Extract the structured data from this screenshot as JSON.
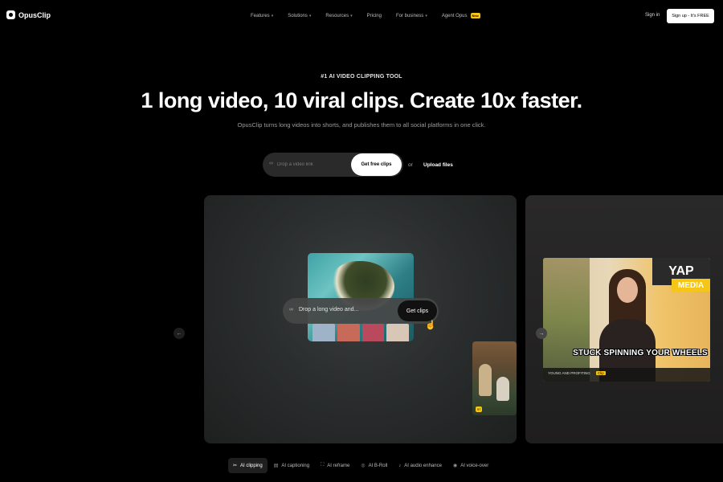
{
  "nav": {
    "logo_text": "OpusClip",
    "links": [
      {
        "label": "Features",
        "chevron": "▾"
      },
      {
        "label": "Solutions",
        "chevron": "▾"
      },
      {
        "label": "Resources",
        "chevron": "▾"
      },
      {
        "label": "Pricing",
        "chevron": ""
      },
      {
        "label": "For business",
        "chevron": "▾"
      },
      {
        "label": "Agent Opus",
        "chevron": ""
      }
    ],
    "agent_badge": "New",
    "signin": "Sign in",
    "signup": "Sign up - It's FREE"
  },
  "hero": {
    "eyebrow": "#1 AI VIDEO CLIPPING TOOL",
    "headline": "1 long video, 10 viral clips. Create 10x faster.",
    "subhead": "OpusClip turns long videos into shorts, and publishes them to all social platforms in one click.",
    "input_placeholder": "Drop a video link",
    "cta": "Get free clips",
    "or": "or",
    "upload": "Upload files"
  },
  "showcase": {
    "drop_text": "Drop a long video and...",
    "get_clips": "Get clips",
    "caption": "STUCK SPINNING YOUR WHEELS",
    "caption_sub": "YOUNG AND PROFITING",
    "caption_badge": "Clip",
    "yap": "YAP",
    "media": "MEDIA",
    "side_chip": "97",
    "icons": {
      "left_arrow": "←",
      "right_arrow": "→",
      "cursor": "☝",
      "link": "∞"
    }
  },
  "tabs": [
    {
      "label": "AI clipping",
      "icon": "✂",
      "active": true
    },
    {
      "label": "AI captioning",
      "icon": "▤",
      "active": false
    },
    {
      "label": "AI reframe",
      "icon": "⛶",
      "active": false
    },
    {
      "label": "AI B-Roll",
      "icon": "◎",
      "active": false
    },
    {
      "label": "AI audio enhance",
      "icon": "♪",
      "active": false
    },
    {
      "label": "AI voice-over",
      "icon": "◉",
      "active": false
    }
  ],
  "colors": {
    "accent": "#f5c518",
    "background": "#000000"
  }
}
